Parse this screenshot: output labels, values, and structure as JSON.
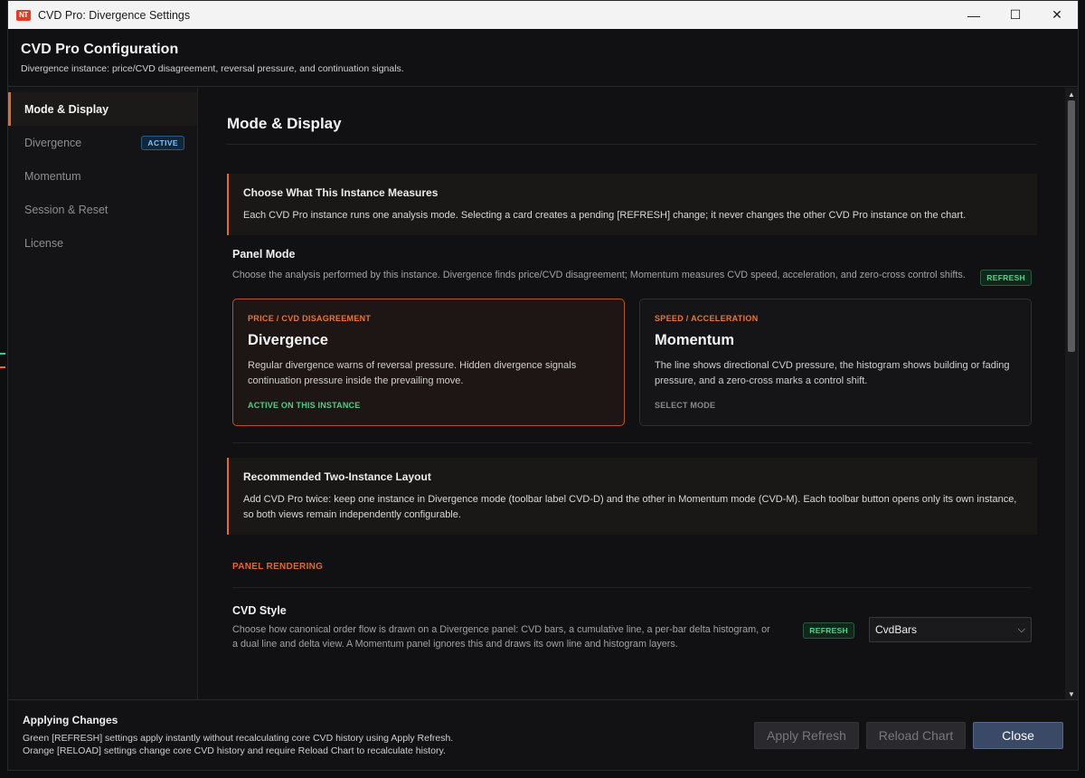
{
  "window": {
    "title": "CVD Pro: Divergence Settings",
    "logo_text": "NT",
    "controls": {
      "minimize": "—",
      "maximize": "☐",
      "close": "✕"
    }
  },
  "header": {
    "title": "CVD Pro Configuration",
    "subtitle": "Divergence instance: price/CVD disagreement, reversal pressure, and continuation signals."
  },
  "sidebar": {
    "items": [
      {
        "label": "Mode & Display",
        "active": true
      },
      {
        "label": "Divergence",
        "badge": "ACTIVE"
      },
      {
        "label": "Momentum"
      },
      {
        "label": "Session & Reset"
      },
      {
        "label": "License"
      }
    ]
  },
  "main": {
    "section_title": "Mode & Display",
    "callout1": {
      "title": "Choose What This Instance Measures",
      "body": "Each CVD Pro instance runs one analysis mode. Selecting a card creates a pending [REFRESH] change; it never changes the other CVD Pro instance on the chart."
    },
    "panel_mode": {
      "title": "Panel Mode",
      "description": "Choose the analysis performed by this instance. Divergence finds price/CVD disagreement; Momentum measures CVD speed, acceleration, and zero-cross control shifts.",
      "badge": "REFRESH"
    },
    "cards": [
      {
        "kicker": "PRICE / CVD DISAGREEMENT",
        "title": "Divergence",
        "body": "Regular divergence warns of reversal pressure. Hidden divergence signals continuation pressure inside the prevailing move.",
        "state": "ACTIVE ON THIS INSTANCE"
      },
      {
        "kicker": "SPEED / ACCELERATION",
        "title": "Momentum",
        "body": "The line shows directional CVD pressure, the histogram shows building or fading pressure, and a zero-cross marks a control shift.",
        "state": "SELECT MODE"
      }
    ],
    "callout2": {
      "title": "Recommended Two-Instance Layout",
      "body": "Add CVD Pro twice: keep one instance in Divergence mode (toolbar label CVD-D) and the other in Momentum mode (CVD-M). Each toolbar button opens only its own instance, so both views remain independently configurable."
    },
    "group_label": "PANEL RENDERING",
    "cvd_style": {
      "title": "CVD Style",
      "description": "Choose how canonical order flow is drawn on a Divergence panel: CVD bars, a cumulative line, a per-bar delta histogram, or a dual line and delta view. A Momentum panel ignores this and draws its own line and histogram layers.",
      "badge": "REFRESH",
      "value": "CvdBars"
    }
  },
  "footer": {
    "title": "Applying Changes",
    "line1": "Green [REFRESH] settings apply instantly without recalculating core CVD history using Apply Refresh.",
    "line2": "Orange [RELOAD] settings change core CVD history and require Reload Chart to recalculate history.",
    "buttons": {
      "apply": "Apply Refresh",
      "reload": "Reload Chart",
      "close": "Close"
    }
  },
  "colors": {
    "accent": "#e8692a",
    "refresh_green": "#52d48a",
    "active_blue": "#7fc3ff",
    "primary_button": "#3a4a66"
  }
}
